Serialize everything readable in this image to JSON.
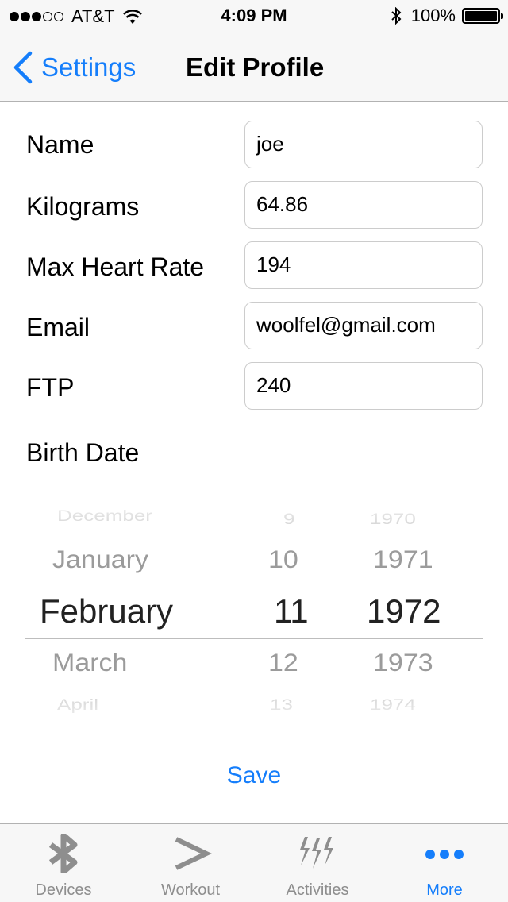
{
  "status_bar": {
    "carrier": "AT&T",
    "time": "4:09 PM",
    "battery": "100%"
  },
  "nav": {
    "back_label": "Settings",
    "title": "Edit Profile"
  },
  "form": {
    "name": {
      "label": "Name",
      "value": "joe"
    },
    "kilograms": {
      "label": "Kilograms",
      "value": "64.86"
    },
    "max_heart_rate": {
      "label": "Max Heart Rate",
      "value": "194"
    },
    "email": {
      "label": "Email",
      "value": "woolfel@gmail.com"
    },
    "ftp": {
      "label": "FTP",
      "value": "240"
    },
    "birth_date_label": "Birth Date"
  },
  "picker": {
    "months": [
      "December",
      "January",
      "February",
      "March",
      "April"
    ],
    "days": [
      "9",
      "10",
      "11",
      "12",
      "13"
    ],
    "years": [
      "1970",
      "1971",
      "1972",
      "1973",
      "1974"
    ],
    "selected": {
      "month": "February",
      "day": "11",
      "year": "1972"
    }
  },
  "save_label": "Save",
  "tabs": [
    {
      "label": "Devices",
      "icon": "bluetooth-icon",
      "active": false
    },
    {
      "label": "Workout",
      "icon": "chevron-right-icon",
      "active": false
    },
    {
      "label": "Activities",
      "icon": "lightning-icon",
      "active": false
    },
    {
      "label": "More",
      "icon": "more-dots-icon",
      "active": true
    }
  ],
  "colors": {
    "accent": "#157efb",
    "inactive_tab": "#8e8e8e",
    "bar_background": "#f7f7f7"
  }
}
